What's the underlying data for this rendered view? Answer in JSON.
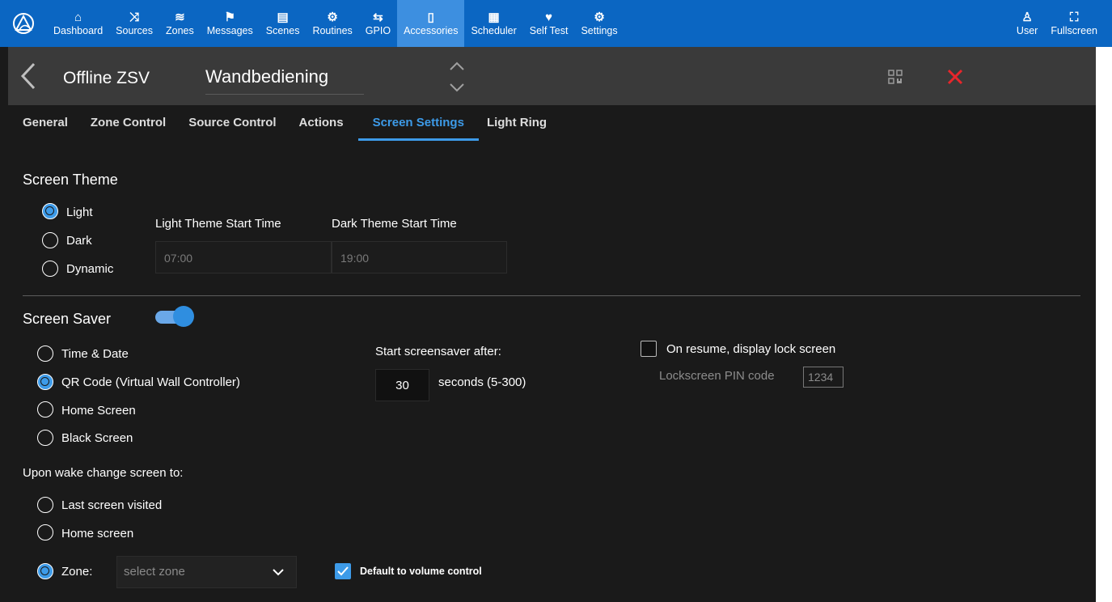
{
  "nav": {
    "items": [
      {
        "label": "Dashboard",
        "icon": "dashboard-icon",
        "glyph": "⌂"
      },
      {
        "label": "Sources",
        "icon": "shuffle-icon",
        "glyph": "⤨"
      },
      {
        "label": "Zones",
        "icon": "layers-icon",
        "glyph": "≋"
      },
      {
        "label": "Messages",
        "icon": "megaphone-icon",
        "glyph": "⚑"
      },
      {
        "label": "Scenes",
        "icon": "clapperboard-icon",
        "glyph": "▤"
      },
      {
        "label": "Routines",
        "icon": "cogs-icon",
        "glyph": "⚙"
      },
      {
        "label": "GPIO",
        "icon": "transfer-icon",
        "glyph": "⇆"
      },
      {
        "label": "Accessories",
        "icon": "tablet-icon",
        "glyph": "▯"
      },
      {
        "label": "Scheduler",
        "icon": "calendar-icon",
        "glyph": "▦"
      },
      {
        "label": "Self Test",
        "icon": "heartbeat-icon",
        "glyph": "♥"
      },
      {
        "label": "Settings",
        "icon": "gear-icon",
        "glyph": "⚙"
      }
    ],
    "right": [
      {
        "label": "User",
        "icon": "user-icon",
        "glyph": "♙"
      },
      {
        "label": "Fullscreen",
        "icon": "fullscreen-icon",
        "glyph": "⛶"
      }
    ],
    "active": "Accessories",
    "accent": "#0b66c2"
  },
  "header": {
    "title": "Offline ZSV",
    "device_name": "Wandbediening"
  },
  "tabs": [
    "General",
    "Zone Control",
    "Source Control",
    "Actions",
    "Screen Settings",
    "Light Ring"
  ],
  "active_tab": "Screen Settings",
  "screen_theme": {
    "title": "Screen Theme",
    "options": [
      "Light",
      "Dark",
      "Dynamic"
    ],
    "selected": "Light",
    "light_label": "Light Theme Start Time",
    "dark_label": "Dark Theme Start Time",
    "light_value": "07:00",
    "dark_value": "19:00"
  },
  "screen_saver": {
    "title": "Screen Saver",
    "enabled": true,
    "options": [
      "Time & Date",
      "QR Code (Virtual Wall Controller)",
      "Home Screen",
      "Black Screen"
    ],
    "selected": "QR Code (Virtual Wall Controller)",
    "start_label": "Start screensaver after:",
    "seconds_value": "30",
    "seconds_label": "seconds (5-300)",
    "lock_label": "On resume, display lock screen",
    "lock_checked": false,
    "pin_label": "Lockscreen PIN code",
    "pin_placeholder": "1234"
  },
  "wake": {
    "title": "Upon wake change screen to:",
    "options": [
      "Last screen visited",
      "Home screen"
    ],
    "zone_label": "Zone:",
    "zone_selected": true,
    "zone_placeholder": "select zone",
    "default_volume_label": "Default to volume control",
    "default_volume_checked": true
  }
}
